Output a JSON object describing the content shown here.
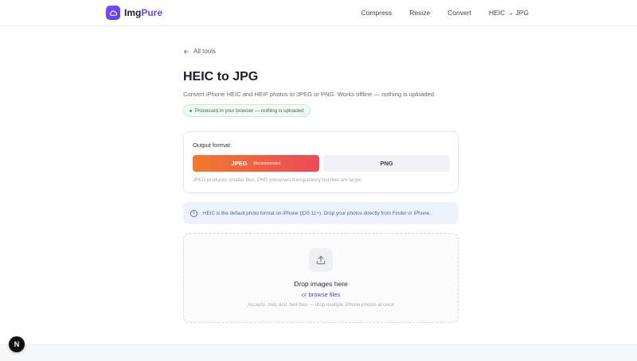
{
  "brand": {
    "name_part1": "Img",
    "name_part2": "Pure",
    "icon": "cloud-icon"
  },
  "nav": {
    "items": [
      "Compress",
      "Resize",
      "Convert",
      "HEIC → JPG"
    ]
  },
  "back_link": "All tools",
  "page_title": "HEIC to JPG",
  "subtitle": "Convert iPhone HEIC and HEIF photos to JPEG or PNG. Works offline — nothing is uploaded.",
  "privacy_badge": "Processed in your browser — nothing is uploaded",
  "output": {
    "label": "Output format:",
    "options": [
      {
        "label": "JPEG",
        "tag": "Recommended",
        "selected": true
      },
      {
        "label": "PNG",
        "tag": "",
        "selected": false
      }
    ],
    "note": "JPEG produces smaller files. PNG preserves transparency but files are larger."
  },
  "info": {
    "icon": "info-icon",
    "text": "HEIC is the default photo format on iPhone (iOS 11+). Drop your photos directly from Finder or iPhone."
  },
  "dropzone": {
    "icon": "upload-icon",
    "title": "Drop images here",
    "or": "or",
    "browse": "browse files",
    "note": "Accepts .heic and .heif files — drop multiple iPhone photos at once"
  },
  "dev_badge": "N",
  "colors": {
    "brand": "#6a43f0",
    "jpeg_from": "#f07a2c",
    "jpeg_to": "#ec4a5a",
    "link": "#4b41d6",
    "success": "#2fa35a"
  }
}
